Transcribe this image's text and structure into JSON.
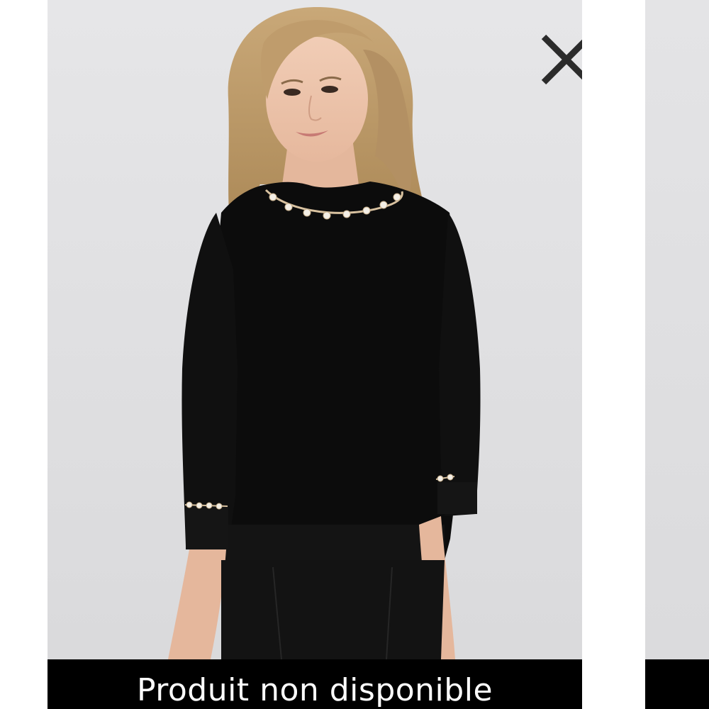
{
  "product_card": {
    "image_alt": "Black sweater with pearl trim",
    "close_icon": "close-icon",
    "status_label": "Produit non disponible"
  },
  "colors": {
    "background": "#ffffff",
    "photo_backdrop": "#e2e2e4",
    "banner": "#000000",
    "banner_text": "#ffffff",
    "close_icon": "#2b2b2b",
    "sweater": "#0c0c0c"
  }
}
